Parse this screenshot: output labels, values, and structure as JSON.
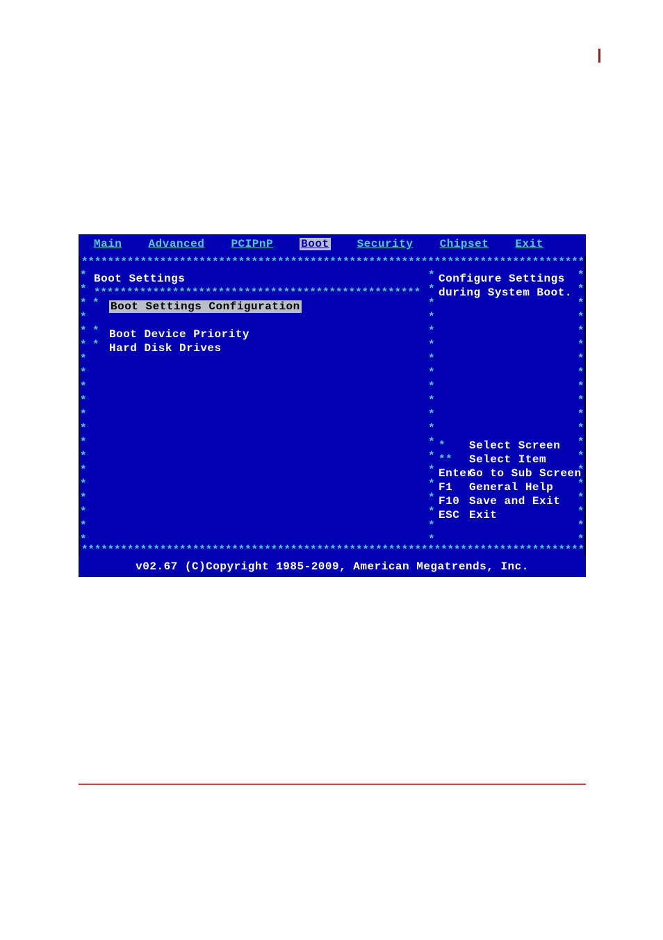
{
  "menu": {
    "items": [
      "Main",
      "Advanced",
      "PCIPnP",
      "Boot",
      "Security",
      "Chipset",
      "Exit"
    ],
    "active_index": 3
  },
  "left_panel": {
    "title": "Boot Settings",
    "items": [
      {
        "label": "Boot Settings Configuration",
        "highlight": true
      },
      {
        "label": "Boot Device Priority",
        "highlight": false
      },
      {
        "label": "Hard Disk Drives",
        "highlight": false
      }
    ]
  },
  "right_panel": {
    "help_lines": [
      "Configure Settings",
      "during System Boot."
    ],
    "keys": [
      {
        "key": "*",
        "label": "Select Screen"
      },
      {
        "key": "**",
        "label": "Select Item"
      },
      {
        "key": "Enter",
        "label": "Go to Sub Screen"
      },
      {
        "key": "F1",
        "label": "General Help"
      },
      {
        "key": "F10",
        "label": "Save and Exit"
      },
      {
        "key": "ESC",
        "label": "Exit"
      }
    ]
  },
  "footer": {
    "copyright": "v02.67 (C)Copyright 1985-2009, American Megatrends, Inc."
  },
  "decor": {
    "star_row": "***********************************************************************************",
    "star_row_short": "**************************************************"
  }
}
